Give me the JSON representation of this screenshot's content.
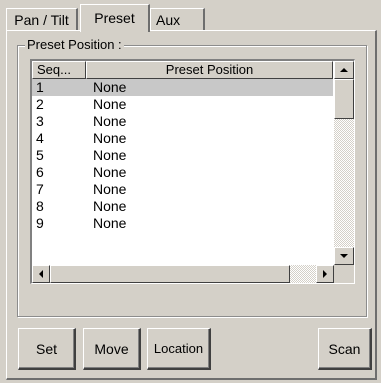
{
  "tabs": [
    {
      "label": "Pan / Tilt",
      "active": false
    },
    {
      "label": "Preset",
      "active": true
    },
    {
      "label": "Aux",
      "active": false
    }
  ],
  "group": {
    "label": "Preset Position :"
  },
  "list": {
    "columns": [
      "Seq...",
      "Preset Position"
    ],
    "rows": [
      {
        "seq": "1",
        "position": "None",
        "selected": true
      },
      {
        "seq": "2",
        "position": "None"
      },
      {
        "seq": "3",
        "position": "None"
      },
      {
        "seq": "4",
        "position": "None"
      },
      {
        "seq": "5",
        "position": "None"
      },
      {
        "seq": "6",
        "position": "None"
      },
      {
        "seq": "7",
        "position": "None"
      },
      {
        "seq": "8",
        "position": "None"
      },
      {
        "seq": "9",
        "position": "None"
      }
    ]
  },
  "buttons": {
    "set": "Set",
    "move": "Move",
    "location": "Location",
    "scan": "Scan"
  },
  "colors": {
    "face": "#d4d0c8",
    "selection": "#c8c8c8"
  }
}
